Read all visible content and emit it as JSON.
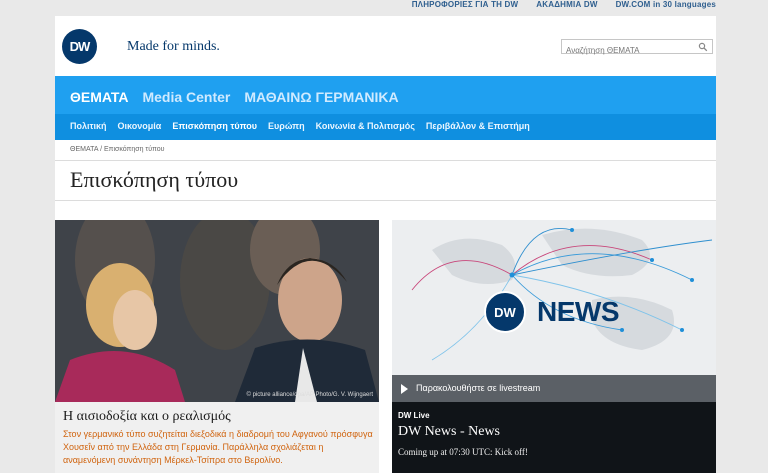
{
  "toplinks": [
    "ΠΛΗΡΟΦΟΡΙΕΣ ΓΙΑ ΤΗ DW",
    "ΑΚΑΔΗΜΙΑ DW",
    "DW.COM in 30 languages"
  ],
  "brand": {
    "logo": "DW",
    "slogan": "Made for minds."
  },
  "search": {
    "placeholder": "Αναζήτηση ΘΕΜΑΤΑ"
  },
  "nav": {
    "main": [
      "ΘΕΜΑΤΑ",
      "Media Center",
      "ΜΑΘΑΙΝΩ ΓΕΡΜΑΝΙΚΑ"
    ],
    "sub": [
      "Πολιτική",
      "Οικονομία",
      "Επισκόπηση τύπου",
      "Ευρώπη",
      "Κοινωνία & Πολιτισμός",
      "Περιβάλλον & Επιστήμη"
    ]
  },
  "breadcrumb": "ΘΕΜΑΤΑ / Επισκόπηση τύπου",
  "page_title": "Επισκόπηση τύπου",
  "article": {
    "credit": "© picture alliance/dpa/AP Photo/G. V. Wijngaert",
    "headline": "Η αισιοδοξία και ο ρεαλισμός",
    "summary": "Στον γερμανικό τύπο συζητείται διεξοδικά η διαδρομή του Αφγανού πρόσφυγα Χουσεΐν από την Ελλάδα στη Γερμανία. Παράλληλα σχολιάζεται η αναμενόμενη συνάντηση Μέρκελ-Τσίπρα στο Βερολίνο."
  },
  "dwnews": {
    "logo_text": "NEWS",
    "livestream": "Παρακολουθήστε σε livestream",
    "kicker": "DW Live",
    "headline": "DW News - News",
    "subtitle": "Coming up at 07:30 UTC: Kick off!"
  }
}
